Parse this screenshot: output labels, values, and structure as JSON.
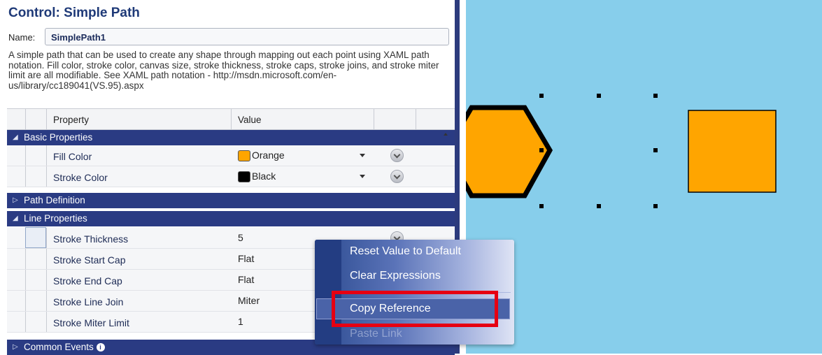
{
  "panel": {
    "title": "Control: Simple Path",
    "name_label": "Name:",
    "name_value": "SimplePath1",
    "description": "A simple path that can be used to create any shape through mapping out each point using XAML path notation. Fill color, stroke color, canvas size, stroke thickness, stroke caps, stroke joins, and stroke miter limit are all modifiable. See XAML path notation - http://msdn.microsoft.com/en-us/library/cc189041(VS.95).aspx"
  },
  "grid": {
    "header_property": "Property",
    "header_value": "Value",
    "categories": {
      "basic": "Basic Properties",
      "path": "Path Definition",
      "line": "Line Properties",
      "events": "Common Events"
    },
    "basic": [
      {
        "name": "Fill Color",
        "value": "Orange",
        "swatch": "#ffa500"
      },
      {
        "name": "Stroke Color",
        "value": "Black",
        "swatch": "#000000"
      }
    ],
    "line": [
      {
        "name": "Stroke Thickness",
        "value": "5"
      },
      {
        "name": "Stroke Start Cap",
        "value": "Flat"
      },
      {
        "name": "Stroke End Cap",
        "value": "Flat"
      },
      {
        "name": "Stroke Line Join",
        "value": "Miter"
      },
      {
        "name": "Stroke Miter Limit",
        "value": "1"
      }
    ]
  },
  "menu": {
    "items": [
      "Reset Value to Default",
      "Clear Expressions",
      "Copy Reference",
      "Paste Link"
    ]
  },
  "colors": {
    "canvas_bg": "#87ceeb",
    "shape_fill": "#ffa500",
    "category_bar": "#2a3b83",
    "highlight": "#e60012"
  }
}
